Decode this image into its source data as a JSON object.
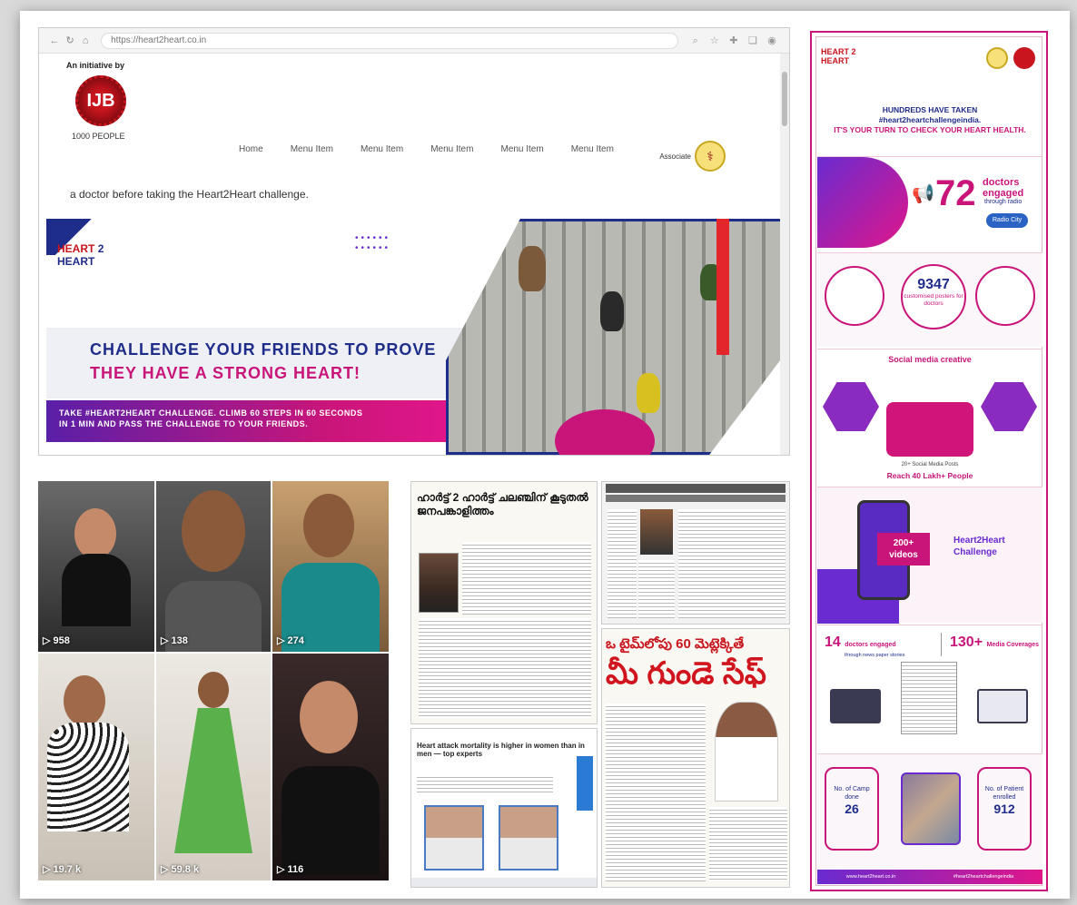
{
  "browser": {
    "url": "https://heart2heart.co.in",
    "nav_icons": [
      "back-icon",
      "refresh-icon",
      "home-icon"
    ],
    "tool_icons": [
      "zoom-icon",
      "favorite-icon",
      "extensions-icon",
      "collections-icon",
      "profile-icon"
    ]
  },
  "site": {
    "initiative_label": "An initiative by",
    "logo_mark": "IJB",
    "logo_text": "1000 PEOPLE",
    "menu": [
      "Home",
      "Menu Item",
      "Menu Item",
      "Menu Item",
      "Menu Item",
      "Menu Item"
    ],
    "assoc_label": "Associate",
    "caption": "a doctor before taking the Heart2Heart challenge.",
    "banner": {
      "logo_line1": "HEART",
      "logo_two": "2",
      "logo_line2": "HEART",
      "headline1": "CHALLENGE YOUR FRIENDS TO PROVE",
      "headline2": "THEY HAVE A STRONG HEART!",
      "cta_line1": "TAKE #HEART2HEART CHALLENGE. CLIMB 60 STEPS IN 60 SECONDS",
      "cta_line2": "IN 1 MIN AND PASS THE CHALLENGE TO YOUR FRIENDS."
    }
  },
  "videos": [
    {
      "count": "▷ 958"
    },
    {
      "count": "▷ 138"
    },
    {
      "count": "▷ 274"
    },
    {
      "count": "▷ 19.7 k"
    },
    {
      "count": "▷ 59.8 k"
    },
    {
      "count": "▷ 116"
    }
  ],
  "news": {
    "malayalam_headline": "ഹാർട്ട് 2 ഹാർട്ട് ചലഞ്ചിന് കൂടുതൽ ജനപങ്കാളിത്തം",
    "telugu_line1": "ఒ టైమ్‌లోపు 60 మెట్లెక్కితే",
    "telugu_line2": "మీ గుండె సేఫ్",
    "article_title": "Heart attack mortality is higher in women than in men — top experts"
  },
  "infographic": {
    "brand_line1": "HEART 2",
    "brand_line2": "HEART",
    "intro_line1": "HUNDREDS HAVE TAKEN",
    "intro_line2": "#heart2heartchallengeindia.",
    "intro_line3": "IT'S YOUR TURN TO CHECK YOUR HEART HEALTH.",
    "doctors_num": "72",
    "doctors_label1": "doctors",
    "doctors_label2": "engaged",
    "doctors_sub": "through radio",
    "radio": "Radio City",
    "posters_num": "9347",
    "posters_label": "customised posters for doctors",
    "social_title": "Social media creative",
    "social_posts": "20+ Social Media Posts",
    "social_reach": "Reach 40 Lakh+ People",
    "videos_num": "200+",
    "videos_word": "videos",
    "challenge1": "Heart2Heart",
    "challenge2": "Challenge",
    "engaged_num": "14",
    "engaged_label": "doctors engaged",
    "engaged_sub": "through news paper stories",
    "media_num": "130+",
    "media_label": "Media Coverages",
    "camp_label": "No. of Camp done",
    "camp_value": "26",
    "patient_label": "No. of Patient enrolled",
    "patient_value": "912",
    "footer_site": "www.heart2heart.co.in",
    "footer_tag": "#heart2heartchallengeindia"
  }
}
